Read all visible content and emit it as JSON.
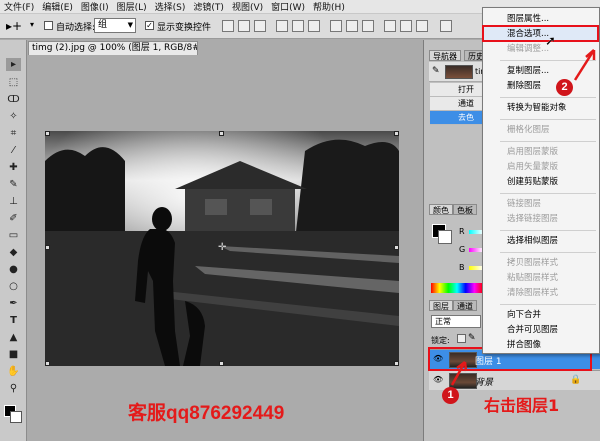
{
  "menubar": {
    "items": [
      "文件(F)",
      "编辑(E)",
      "图像(I)",
      "图层(L)",
      "选择(S)",
      "滤镜(T)",
      "视图(V)",
      "窗口(W)",
      "帮助(H)"
    ]
  },
  "options": {
    "auto_select_label": "自动选择:",
    "auto_select_value": "组",
    "show_transform_label": "显示变换控件",
    "auto_select_checked": false,
    "show_transform_checked": true
  },
  "document": {
    "tab_title": "timg (2).jpg @ 100% (图层 1, RGB/8#) *",
    "close": "×"
  },
  "panels": {
    "top_tabs": [
      "导航器",
      "历史"
    ],
    "history_doc": "tim",
    "history_rows": [
      "打开",
      "通道",
      "去色"
    ],
    "color_tabs": [
      "颜色",
      "色板"
    ],
    "color_channels": [
      "R",
      "G",
      "B"
    ],
    "layer_tabs": [
      "图层",
      "通道"
    ],
    "blend_mode": "正常",
    "lock_label": "锁定:"
  },
  "layers": [
    {
      "name": "图层 1",
      "selected": true
    },
    {
      "name": "背景",
      "selected": false,
      "locked": true
    }
  ],
  "context_menu": {
    "items": [
      {
        "label": "图层属性...",
        "disabled": false
      },
      {
        "label": "混合选项...",
        "disabled": false,
        "highlighted": true
      },
      {
        "label": "编辑调整...",
        "disabled": true
      },
      {
        "label": "复制图层...",
        "disabled": false
      },
      {
        "label": "删除图层",
        "disabled": false
      },
      {
        "label": "转换为智能对象",
        "disabled": false
      },
      {
        "label": "栅格化图层",
        "disabled": true
      },
      {
        "label": "启用图层蒙版",
        "disabled": true
      },
      {
        "label": "启用矢量蒙版",
        "disabled": true
      },
      {
        "label": "创建剪贴蒙版",
        "disabled": false
      },
      {
        "label": "链接图层",
        "disabled": true
      },
      {
        "label": "选择链接图层",
        "disabled": true
      },
      {
        "label": "选择相似图层",
        "disabled": false
      },
      {
        "label": "拷贝图层样式",
        "disabled": true
      },
      {
        "label": "粘贴图层样式",
        "disabled": true
      },
      {
        "label": "清除图层样式",
        "disabled": true
      },
      {
        "label": "向下合并",
        "disabled": false
      },
      {
        "label": "合并可见图层",
        "disabled": false
      },
      {
        "label": "拼合图像",
        "disabled": false
      }
    ]
  },
  "annotations": {
    "contact": "客服qq876292449",
    "step1_badge": "1",
    "step2_badge": "2",
    "right_click_hint": "右击图层1"
  },
  "colors": {
    "annotation_red": "#e41a1a",
    "selection_blue": "#3d8ee6",
    "menu_highlight": "#dfe9f7"
  }
}
